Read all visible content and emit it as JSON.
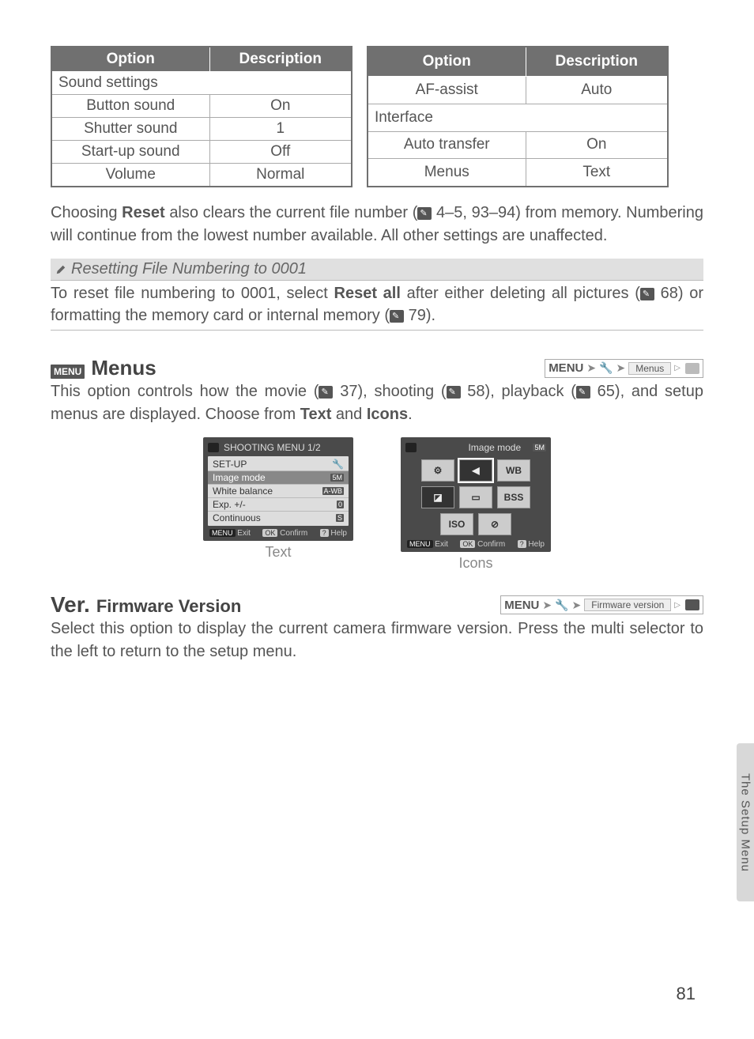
{
  "tables": {
    "left": {
      "headers": [
        "Option",
        "Description"
      ],
      "section": "Sound settings",
      "rows": [
        [
          "Button sound",
          "On"
        ],
        [
          "Shutter sound",
          "1"
        ],
        [
          "Start-up sound",
          "Off"
        ],
        [
          "Volume",
          "Normal"
        ]
      ]
    },
    "right": {
      "headers": [
        "Option",
        "Description"
      ],
      "first_row": [
        "AF-assist",
        "Auto"
      ],
      "section": "Interface",
      "rows": [
        [
          "Auto transfer",
          "On"
        ],
        [
          "Menus",
          "Text"
        ]
      ]
    }
  },
  "reset_para": {
    "t1": "Choosing ",
    "bold": "Reset",
    "t2": " also clears the current file number (",
    "ref1": " 4–5, 93–94) from memory.  Numbering will continue from the lowest number available.  All other settings are unaffected."
  },
  "note": {
    "title": "Resetting File Numbering to 0001",
    "b1": "To reset file numbering to 0001, select ",
    "bold": "Reset all",
    "b2": " after either deleting all pictures  (",
    "r1": " 68) or formatting the memory card or internal memory (",
    "r2": " 79)."
  },
  "menus": {
    "badge": "MENU",
    "title": "Menus",
    "crumb": {
      "menu": "MENU",
      "label": "Menus"
    },
    "p1": "This option controls how the movie (",
    "r1": " 37), shooting (",
    "r2": " 58), playback (",
    "r3": " 65), and setup menus are displayed.  Choose from ",
    "b1": "Text",
    "mid": " and ",
    "b2": "Icons",
    "end": "."
  },
  "text_screen": {
    "title": "SHOOTING MENU  1/2",
    "rows": [
      "SET-UP",
      "Image mode",
      "White balance",
      "Exp. +/-",
      "Continuous"
    ],
    "tags": [
      "",
      "5M",
      "A-WB",
      "0",
      "S"
    ],
    "footer": [
      "Exit",
      "Confirm",
      "Help"
    ],
    "caption": "Text"
  },
  "icons_screen": {
    "title": "Image mode",
    "title_tag": "5M",
    "cells": [
      "⚙",
      "◀",
      "WB",
      "◪",
      "▭",
      "BSS",
      "ISO",
      "⊘"
    ],
    "footer": [
      "Exit",
      "Confirm",
      "Help"
    ],
    "caption": "Icons"
  },
  "firmware": {
    "ver": "Ver.",
    "title": "Firmware Version",
    "crumb": {
      "menu": "MENU",
      "label": "Firmware version"
    },
    "para": "Select this option to display the current camera firmware version.  Press the multi selector to the left to return to the setup menu."
  },
  "side_tab": "The Setup Menu",
  "page": "81"
}
